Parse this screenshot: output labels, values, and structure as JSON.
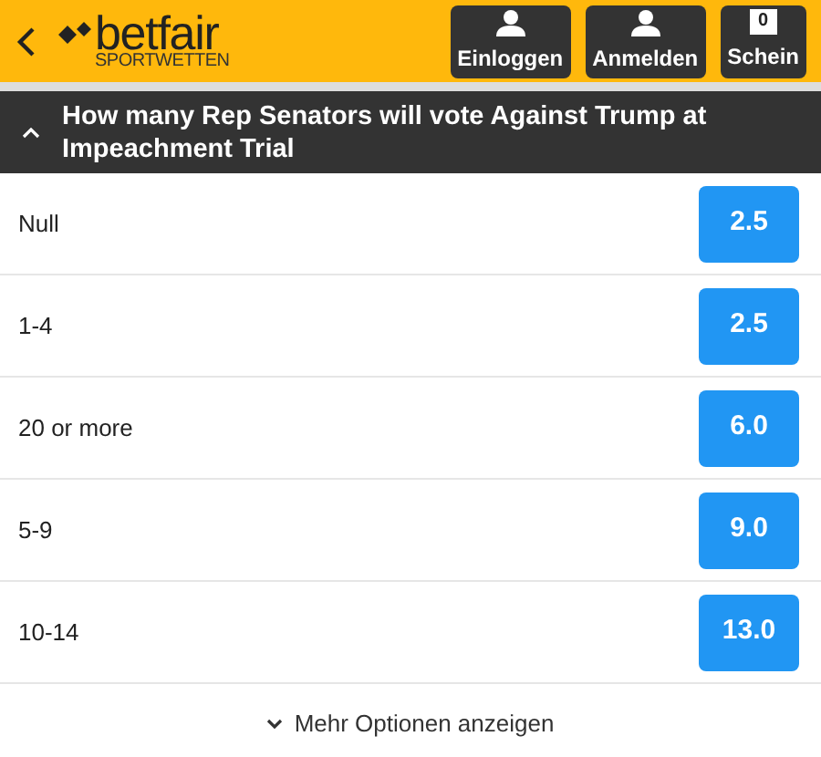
{
  "header": {
    "brand": "betfair",
    "tagline": "SPORTWETTEN",
    "buttons": [
      {
        "kind": "person",
        "label": "Einloggen"
      },
      {
        "kind": "person",
        "label": "Anmelden"
      },
      {
        "kind": "count",
        "count": "0",
        "label": "Schein"
      }
    ]
  },
  "market": {
    "title": "How many Rep Senators will vote Against Trump at Impeachment Trial",
    "expanded": true
  },
  "selections": [
    {
      "name": "Null",
      "odds": "2.5"
    },
    {
      "name": "1-4",
      "odds": "2.5"
    },
    {
      "name": "20 or more",
      "odds": "6.0"
    },
    {
      "name": "5-9",
      "odds": "9.0"
    },
    {
      "name": "10-14",
      "odds": "13.0"
    }
  ],
  "more_link": "Mehr Optionen anzeigen"
}
